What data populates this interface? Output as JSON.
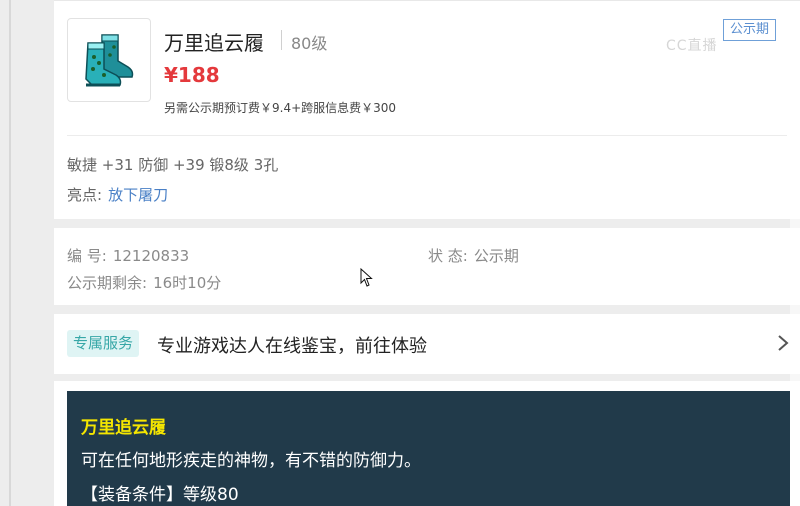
{
  "item": {
    "name": "万里追云履",
    "level": "80级",
    "price": "¥188",
    "fee_note": "另需公示期预订费￥9.4+跨服信息费￥300",
    "status_tag": "公示期",
    "watermark": "CC直播",
    "attributes": "敏捷 +31 防御 +39 锻8级 3孔",
    "highlight_label": "亮点:",
    "highlight_value": "放下屠刀"
  },
  "info": {
    "serial_label": "编 号:",
    "serial_value": "12120833",
    "status_label": "状 态:",
    "status_value": "公示期",
    "remaining_label": "公示期剩余:",
    "remaining_value": "16时10分"
  },
  "service": {
    "badge": "专属服务",
    "text": "专业游戏达人在线鉴宝，前往体验"
  },
  "description": {
    "title": "万里追云履",
    "line1": "可在任何地形疾走的神物，有不错的防御力。",
    "requirement": "【装备条件】等级80"
  },
  "colors": {
    "price": "#e4393c",
    "status_tag": "#5b8fd0",
    "highlight": "#4a80c6",
    "service_badge_bg": "#dff4f4",
    "desc_bg": "#213a4a",
    "desc_title": "#f5e600"
  },
  "icons": {
    "thumbnail": "boots-icon",
    "service_arrow": "chevron-right-icon",
    "cursor": "mouse-cursor-icon"
  }
}
